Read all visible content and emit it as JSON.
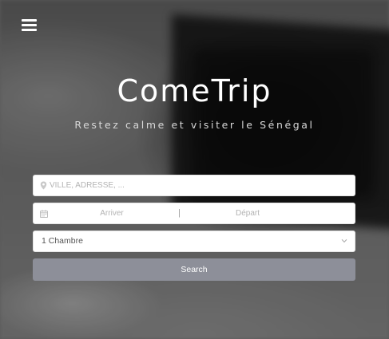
{
  "header": {
    "menu_icon": "hamburger-menu-icon"
  },
  "hero": {
    "brand": "ComeTrip",
    "tagline": "Restez calme et visiter le Sénégal"
  },
  "form": {
    "location": {
      "placeholder": "VILLE, ADRESSE, ...",
      "value": "",
      "icon": "map-pin-icon"
    },
    "dates": {
      "icon": "calendar-icon",
      "arrive_placeholder": "Arriver",
      "separator": "|",
      "depart_placeholder": "Départ"
    },
    "rooms": {
      "selected": "1 Chambre",
      "icon": "chevron-down-icon"
    },
    "search_label": "Search"
  },
  "colors": {
    "button_bg": "#8d8f99",
    "field_bg": "#ffffff",
    "title": "#ffffff"
  }
}
